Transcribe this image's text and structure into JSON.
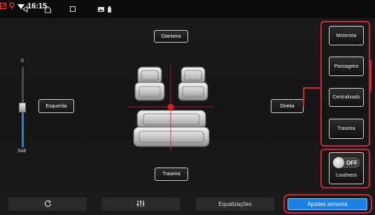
{
  "statusbar": {
    "time": "16:15"
  },
  "balance": {
    "front_label": "Dianteira",
    "rear_label": "Traseira",
    "left_label": "Esquerda",
    "right_label": "Direita"
  },
  "subwoofer": {
    "top_value": "0",
    "label": "Sub",
    "level": 0.5
  },
  "zones": [
    {
      "label": "Motorista"
    },
    {
      "label": "Passageiro"
    },
    {
      "label": "Centralizado"
    },
    {
      "label": "Traseira"
    }
  ],
  "loudness": {
    "state": "OFF",
    "label": "Loudness"
  },
  "bottom": {
    "equalization_label": "Equalizações",
    "sound_settings_label": "Ajustes sonoros"
  },
  "colors": {
    "accent": "#1a82e4",
    "highlight": "#d1263a",
    "focus_dot": "#e0192b"
  }
}
